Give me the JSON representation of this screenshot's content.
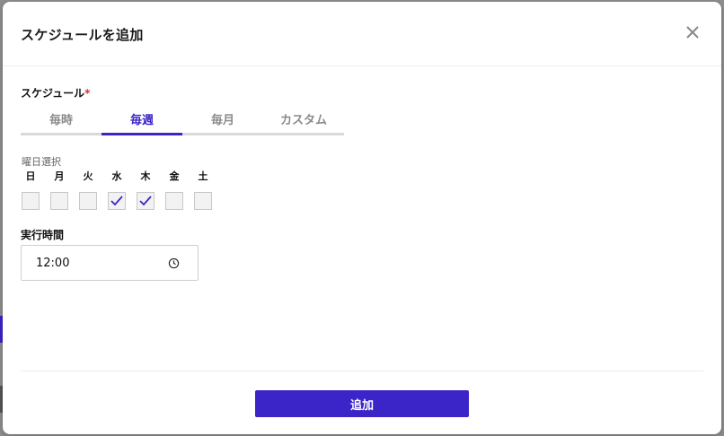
{
  "dialog": {
    "title": "スケジュールを追加",
    "close_icon": "close-icon"
  },
  "schedule": {
    "label": "スケジュール",
    "required_mark": "*",
    "tabs": [
      {
        "label": "毎時",
        "active": false
      },
      {
        "label": "毎週",
        "active": true
      },
      {
        "label": "毎月",
        "active": false
      },
      {
        "label": "カスタム",
        "active": false
      }
    ]
  },
  "weekdays": {
    "label": "曜日選択",
    "days": [
      {
        "name": "日",
        "checked": false
      },
      {
        "name": "月",
        "checked": false
      },
      {
        "name": "火",
        "checked": false
      },
      {
        "name": "水",
        "checked": true
      },
      {
        "name": "木",
        "checked": true
      },
      {
        "name": "金",
        "checked": false
      },
      {
        "name": "土",
        "checked": false
      }
    ]
  },
  "run_time": {
    "label": "実行時間",
    "value": "12:00",
    "icon": "clock-icon"
  },
  "footer": {
    "add_label": "追加"
  },
  "colors": {
    "accent": "#3b24c8",
    "required": "#d0342c"
  }
}
